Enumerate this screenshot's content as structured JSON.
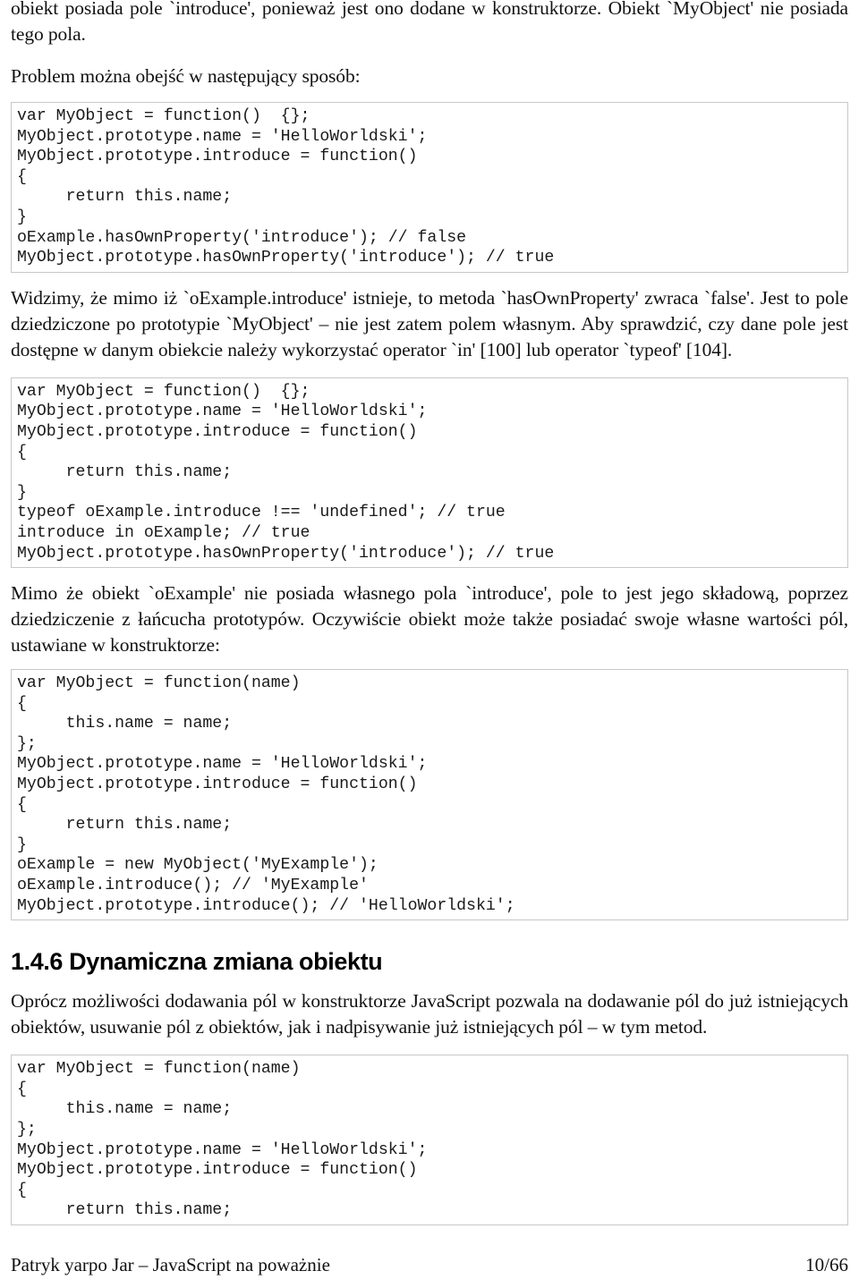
{
  "document": {
    "language": "pl",
    "intro_paragraph": "obiekt posiada pole `introduce', ponieważ jest ono dodane w konstruktorze. Obiekt `MyObject' nie posiada tego pola.",
    "workaround_paragraph": "Problem można obejść w następujący sposób:",
    "code_block_1": "var MyObject = function()  {};\nMyObject.prototype.name = 'HelloWorldski';\nMyObject.prototype.introduce = function()\n{\n     return this.name;\n}\noExample.hasOwnProperty('introduce'); // false\nMyObject.prototype.hasOwnProperty('introduce'); // true",
    "explanation_paragraph": "Widzimy, że mimo iż `oExample.introduce' istnieje, to metoda `hasOwnProperty' zwraca `false'. Jest to pole dziedziczone po prototypie `MyObject' – nie jest zatem polem własnym. Aby sprawdzić, czy dane pole jest dostępne w danym obiekcie należy wykorzystać operator `in' [100] lub operator `typeof' [104].",
    "code_block_2": "var MyObject = function()  {};\nMyObject.prototype.name = 'HelloWorldski';\nMyObject.prototype.introduce = function()\n{\n     return this.name;\n}\ntypeof oExample.introduce !== 'undefined'; // true\nintroduce in oExample; // true\nMyObject.prototype.hasOwnProperty('introduce'); // true",
    "inheritance_paragraph": "Mimo że obiekt `oExample' nie posiada własnego pola `introduce', pole to jest jego składową, poprzez dziedziczenie z łańcucha prototypów. Oczywiście obiekt może także posiadać swoje własne wartości pól, ustawiane w konstruktorze:",
    "code_block_3": "var MyObject = function(name)\n{\n     this.name = name;\n};\nMyObject.prototype.name = 'HelloWorldski';\nMyObject.prototype.introduce = function()\n{\n     return this.name;\n}\noExample = new MyObject('MyExample');\noExample.introduce(); // 'MyExample'\nMyObject.prototype.introduce(); // 'HelloWorldski';",
    "section_heading": "1.4.6 Dynamiczna zmiana obiektu",
    "section_paragraph": "Oprócz możliwości dodawania pól w konstruktorze JavaScript pozwala na dodawanie pól do już istniejących obiektów, usuwanie pól z obiektów, jak i nadpisywanie już istniejących pól – w tym metod.",
    "code_block_4": "var MyObject = function(name)\n{\n     this.name = name;\n};\nMyObject.prototype.name = 'HelloWorldski';\nMyObject.prototype.introduce = function()\n{\n     return this.name;"
  },
  "footer": {
    "author_line": "Patryk yarpo Jar – JavaScript na poważnie",
    "page_number": "10/66"
  },
  "style": {
    "code_border_color": "#c8c8c8",
    "text_color": "#111111"
  }
}
